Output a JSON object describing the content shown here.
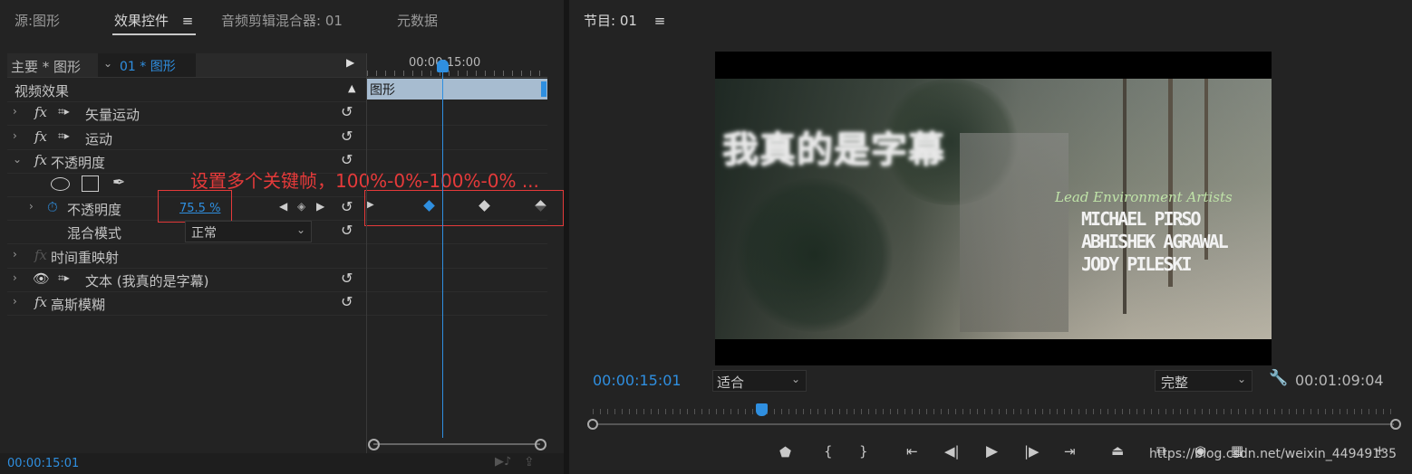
{
  "left_tabs": [
    {
      "label": "源:图形"
    },
    {
      "label": "效果控件"
    },
    {
      "label": "音频剪辑混合器: 01"
    },
    {
      "label": "元数据"
    }
  ],
  "effect_controls": {
    "master_label": "主要 * 图形",
    "clip_label": "01 * 图形",
    "timecode_ruler": "00:00:15:00",
    "clip_bar_label": "图形",
    "section_header": "视频效果",
    "effects": {
      "vector_motion": "矢量运动",
      "motion": "运动",
      "opacity": "不透明度",
      "opacity_prop": "不透明度",
      "opacity_value": "75.5 %",
      "blend_mode_label": "混合模式",
      "blend_mode_value": "正常",
      "time_remap": "时间重映射",
      "text_layer": "文本 (我真的是字幕)",
      "gaussian_blur": "高斯模糊"
    },
    "current_time": "00:00:15:01",
    "keyframe_note": "设置多个关键帧，100%-0%-100%-0% ..."
  },
  "program": {
    "title": "节目: 01",
    "video": {
      "subtitle": "我真的是字幕",
      "credit_role": "Lead Environment Artists",
      "credit_names": [
        "MICHAEL PIRSO",
        "ABHISHEK AGRAWAL",
        "JODY PILESKI"
      ]
    },
    "current_time": "00:00:15:01",
    "fit_value": "适合",
    "quality_value": "完整",
    "duration": "00:01:09:04",
    "watermark": "https://blog.csdn.net/weixin_44949135"
  },
  "colors": {
    "accent": "#2f8fe0",
    "annotation": "#e53a3a"
  }
}
